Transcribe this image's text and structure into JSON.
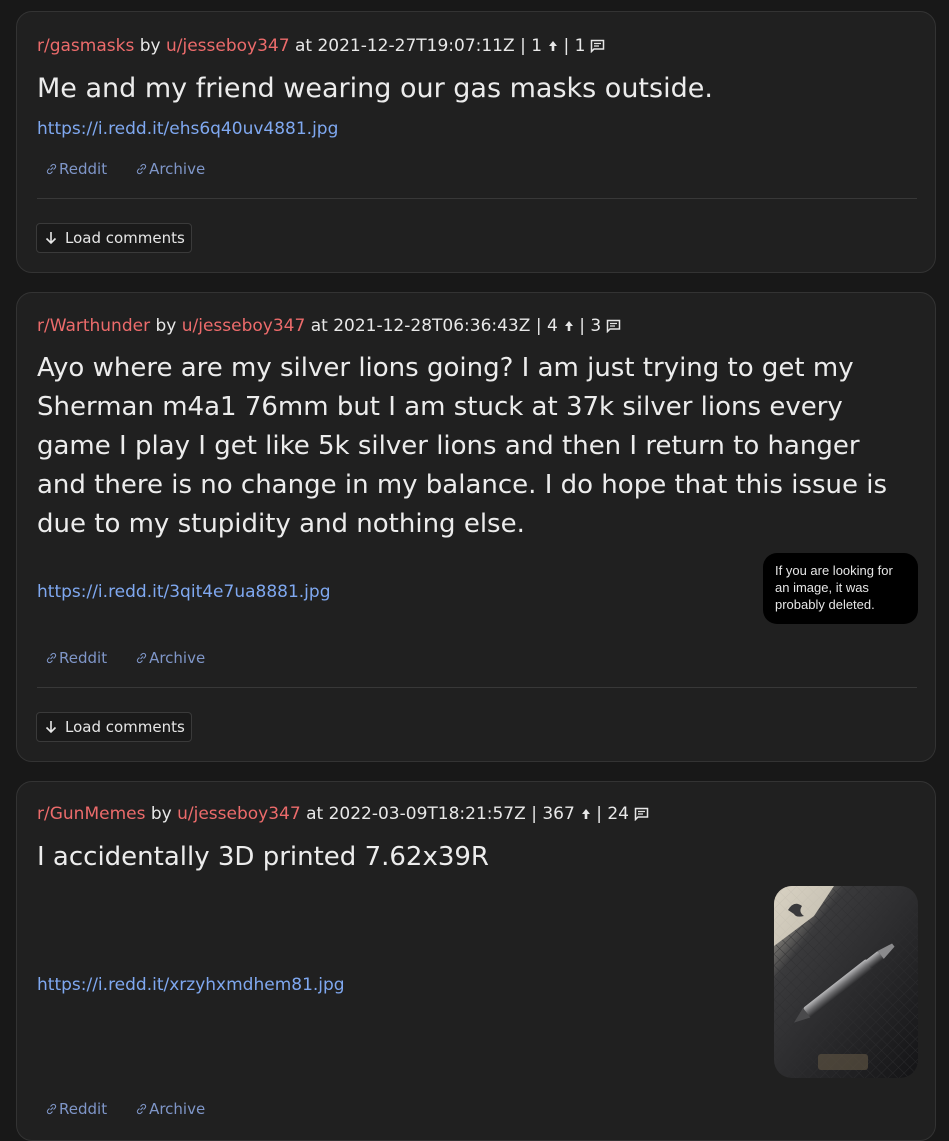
{
  "posts": [
    {
      "subreddit": "r/gasmasks",
      "by": "by",
      "user": "u/jesseboy347",
      "at": "at",
      "timestamp": "2021-12-27T19:07:11Z",
      "sep": "|",
      "upvotes": "1",
      "comments": "1",
      "title": "Me and my friend wearing our gas masks outside.",
      "link": "https://i.redd.it/ehs6q40uv4881.jpg",
      "nav_reddit": "Reddit",
      "nav_archive": "Archive",
      "load_comments": "Load comments"
    },
    {
      "subreddit": "r/Warthunder",
      "by": "by",
      "user": "u/jesseboy347",
      "at": "at",
      "timestamp": "2021-12-28T06:36:43Z",
      "sep": "|",
      "upvotes": "4",
      "comments": "3",
      "title": "Ayo where are my silver lions going? I am just trying to get my Sherman m4a1 76mm but I am stuck at 37k silver lions every game I play I get like 5k silver lions and then I return to hanger and there is no change in my balance. I do hope that this issue is due to my stupidity and nothing else.",
      "link": "https://i.redd.it/3qit4e7ua8881.jpg",
      "image_placeholder": "If you are looking for an image, it was probably deleted.",
      "nav_reddit": "Reddit",
      "nav_archive": "Archive",
      "load_comments": "Load comments"
    },
    {
      "subreddit": "r/GunMemes",
      "by": "by",
      "user": "u/jesseboy347",
      "at": "at",
      "timestamp": "2022-03-09T18:21:57Z",
      "sep": "|",
      "upvotes": "367",
      "comments": "24",
      "title": "I accidentally 3D printed 7.62x39R",
      "link": "https://i.redd.it/xrzyhxmdhem81.jpg",
      "nav_reddit": "Reddit",
      "nav_archive": "Archive"
    }
  ],
  "icons": {
    "upvote": "arrow-up-icon",
    "comments": "comment-icon",
    "link": "chain-link-icon",
    "load": "arrow-down-icon"
  },
  "colors": {
    "page_bg": "#181818",
    "card_bg": "#202020",
    "subreddit": "#ec6b6b",
    "link": "#7fa8f0",
    "nav": "#7f96c8"
  }
}
